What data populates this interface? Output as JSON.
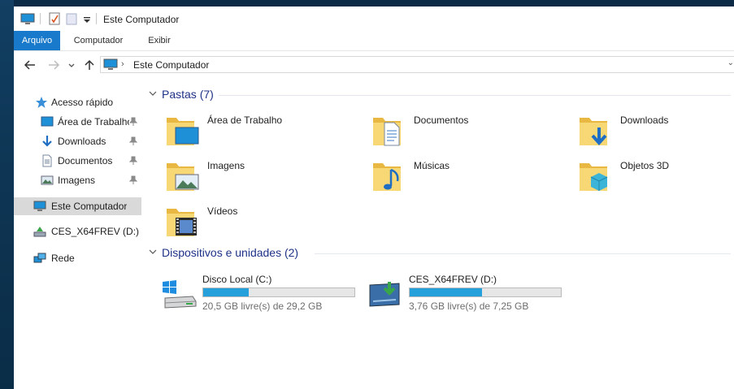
{
  "window": {
    "title": "Este Computador"
  },
  "ribbon": {
    "tabs": [
      {
        "label": "Arquivo",
        "active": true
      },
      {
        "label": "Computador"
      },
      {
        "label": "Exibir"
      }
    ]
  },
  "address": {
    "path": "Este Computador"
  },
  "nav": {
    "items": [
      {
        "label": "Acesso rápido",
        "icon": "star-icon"
      },
      {
        "label": "Área de Trabalho",
        "icon": "desktop-icon",
        "pinned": true
      },
      {
        "label": "Downloads",
        "icon": "download-arrow-icon",
        "pinned": true
      },
      {
        "label": "Documentos",
        "icon": "document-icon",
        "pinned": true
      },
      {
        "label": "Imagens",
        "icon": "pictures-icon",
        "pinned": true
      },
      {
        "label": "Este Computador",
        "icon": "computer-icon",
        "selected": true
      },
      {
        "label": "CES_X64FREV (D:)",
        "icon": "dvd-drive-icon"
      },
      {
        "label": "Rede",
        "icon": "network-icon"
      }
    ]
  },
  "folders": {
    "heading": "Pastas (7)",
    "items": [
      {
        "label": "Área de Trabalho",
        "icon": "desktop-folder-icon"
      },
      {
        "label": "Documentos",
        "icon": "documents-folder-icon"
      },
      {
        "label": "Downloads",
        "icon": "downloads-folder-icon"
      },
      {
        "label": "Imagens",
        "icon": "pictures-folder-icon"
      },
      {
        "label": "Músicas",
        "icon": "music-folder-icon"
      },
      {
        "label": "Objetos 3D",
        "icon": "3d-objects-folder-icon"
      },
      {
        "label": "Vídeos",
        "icon": "videos-folder-icon"
      }
    ]
  },
  "devices": {
    "heading": "Dispositivos e unidades (2)",
    "items": [
      {
        "label": "Disco Local (C:)",
        "free": "20,5 GB livre(s) de 29,2 GB",
        "used_fraction": 0.3,
        "icon": "windows-drive-icon"
      },
      {
        "label": "CES_X64FREV (D:)",
        "free": "3,76 GB livre(s) de 7,25 GB",
        "used_fraction": 0.48,
        "icon": "dvd-install-drive-icon"
      }
    ]
  },
  "colors": {
    "accent": "#1979ca",
    "group_heading": "#1e3287",
    "bar_fill": "#26a0da",
    "folder": "#f5c94f"
  }
}
